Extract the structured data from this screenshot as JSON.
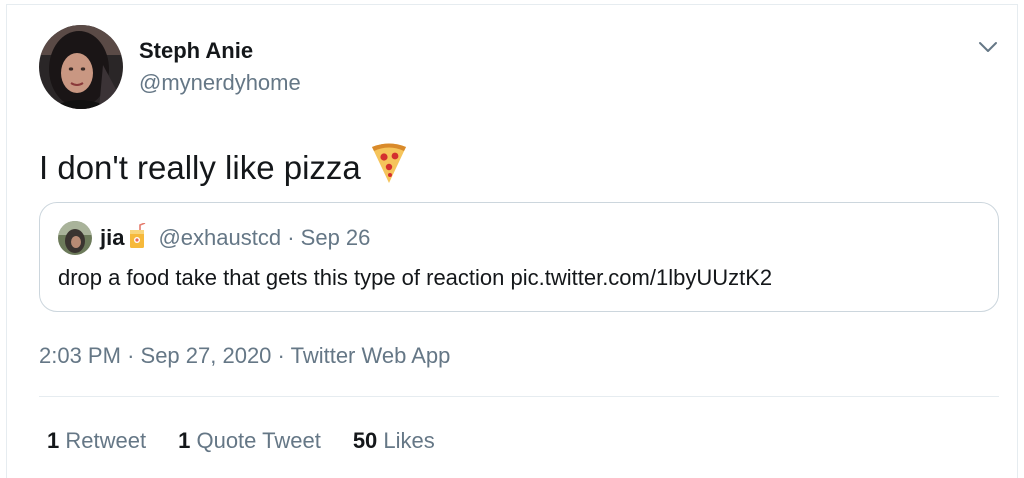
{
  "author": {
    "name": "Steph Anie",
    "handle": "@mynerdyhome"
  },
  "tweet": {
    "text": "I don't really like pizza",
    "emoji_icon": "pizza-icon"
  },
  "quoted_tweet": {
    "name": "jia",
    "name_emoji_icon": "juice-box-icon",
    "handle": "@exhaustcd",
    "separator": "·",
    "date": "Sep 26",
    "text": "drop a food take that gets this type of reaction pic.twitter.com/1lbyUUztK2"
  },
  "meta": {
    "time": "2:03 PM",
    "separator": "·",
    "date": "Sep 27, 2020",
    "source": "Twitter Web App"
  },
  "stats": {
    "retweets_count": "1",
    "retweets_label": "Retweet",
    "quotes_count": "1",
    "quotes_label": "Quote Tweet",
    "likes_count": "50",
    "likes_label": "Likes"
  },
  "colors": {
    "primary_text": "#14171a",
    "secondary_text": "#657786",
    "border": "#ccd6dd",
    "divider": "#e6ecf0"
  }
}
